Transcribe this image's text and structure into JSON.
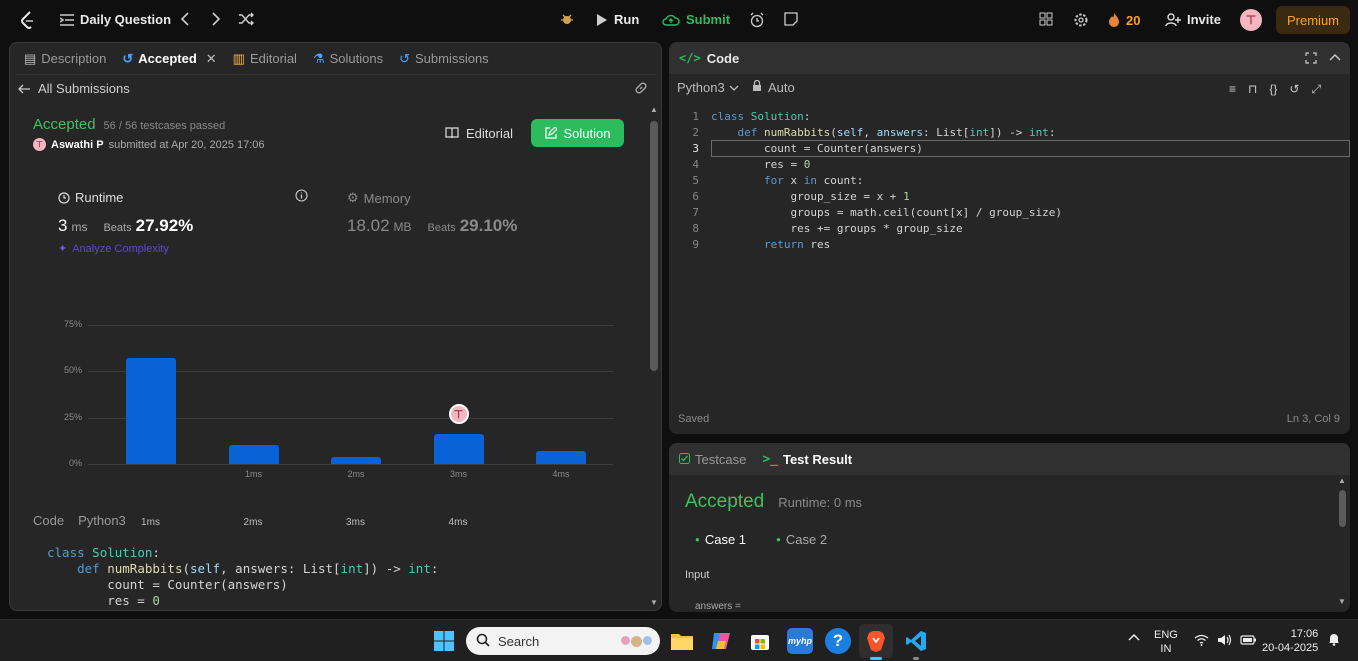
{
  "topbar": {
    "daily_question": "Daily Question",
    "run": "Run",
    "submit": "Submit",
    "streak": "20",
    "invite": "Invite",
    "premium": "Premium"
  },
  "left": {
    "tabs": [
      "Description",
      "Accepted",
      "Editorial",
      "Solutions",
      "Submissions"
    ],
    "all_submissions": "All Submissions",
    "status": "Accepted",
    "testcases": "56 / 56 testcases passed",
    "user": "Aswathi P",
    "submitted_at": "submitted at Apr 20, 2025 17:06",
    "editorial_btn": "Editorial",
    "solution_btn": "Solution",
    "runtime_label": "Runtime",
    "runtime_value": "3",
    "runtime_unit": "ms",
    "beats_label": "Beats",
    "runtime_beats": "27.92%",
    "analyze": "Analyze Complexity",
    "memory_label": "Memory",
    "memory_value": "18.02",
    "memory_unit": "MB",
    "memory_beats": "29.10%",
    "code_label": "Code",
    "lang_label": "Python3"
  },
  "chart_data": {
    "type": "bar",
    "categories": [
      "",
      "1ms",
      "2ms",
      "3ms",
      "4ms"
    ],
    "values": [
      57,
      10,
      4,
      16,
      7
    ],
    "ylim": [
      0,
      75
    ],
    "yticks": [
      "0%",
      "25%",
      "50%",
      "75%"
    ],
    "highlight_category": "3ms",
    "bottom_labels": [
      "1ms",
      "2ms",
      "3ms",
      "4ms"
    ],
    "bar_color": "#0a63d6"
  },
  "code_panel": {
    "title": "Code",
    "language": "Python3",
    "mode": "Auto",
    "saved": "Saved",
    "cursor": "Ln 3, Col 9",
    "line_numbers": [
      "1",
      "2",
      "3",
      "4",
      "5",
      "6",
      "7",
      "8",
      "9"
    ]
  },
  "result_panel": {
    "testcase_tab": "Testcase",
    "result_tab": "Test Result",
    "status": "Accepted",
    "runtime": "Runtime: 0 ms",
    "case1": "Case 1",
    "case2": "Case 2",
    "input_label": "Input",
    "answers_label": "answers ="
  },
  "taskbar": {
    "search": "Search",
    "lang1": "ENG",
    "lang2": "IN",
    "time": "17:06",
    "date": "20-04-2025"
  },
  "colors": {
    "accent_green": "#2cbb5d",
    "accepted_green": "#3ec15f",
    "premium_bg": "#3a2a12",
    "premium_text": "#ffa116"
  }
}
